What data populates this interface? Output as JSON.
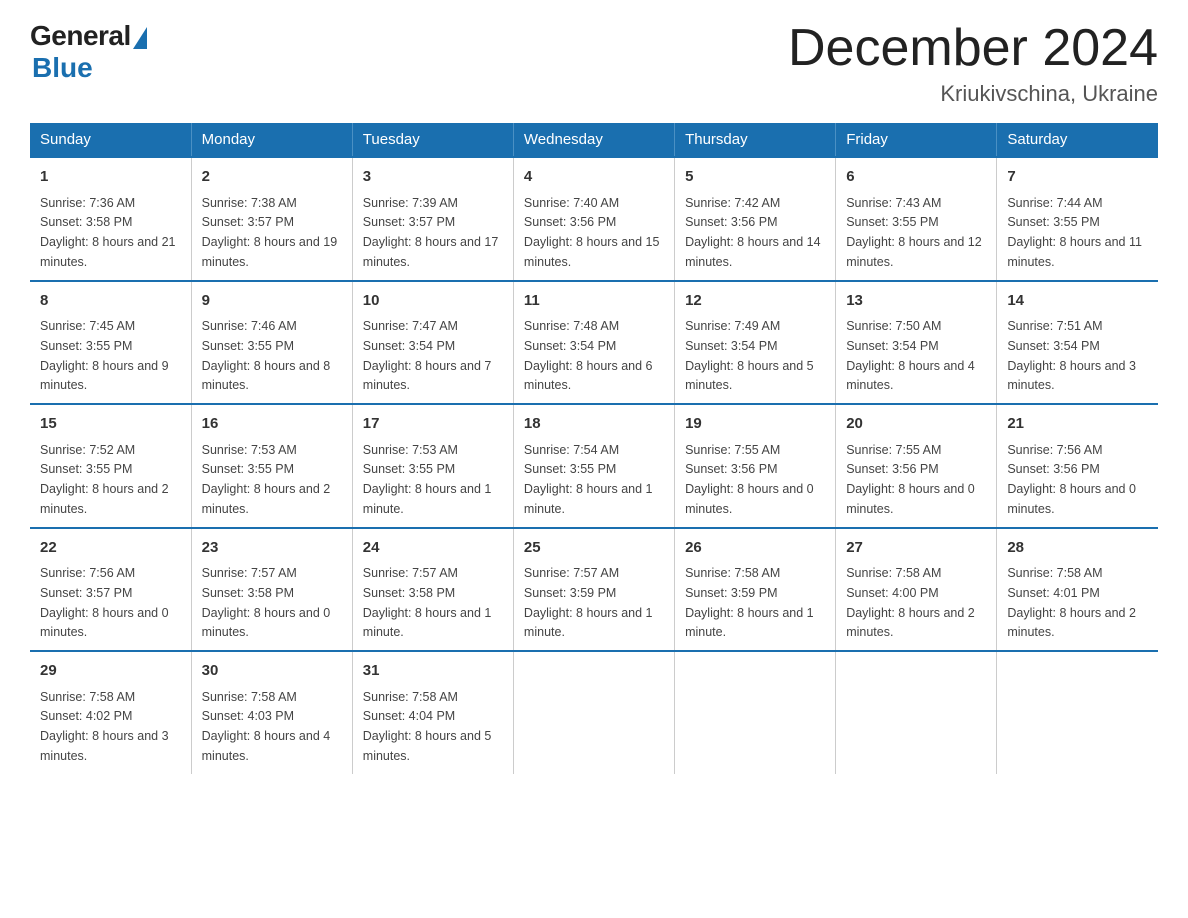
{
  "logo": {
    "general": "General",
    "blue": "Blue"
  },
  "title": "December 2024",
  "location": "Kriukivschina, Ukraine",
  "days_of_week": [
    "Sunday",
    "Monday",
    "Tuesday",
    "Wednesday",
    "Thursday",
    "Friday",
    "Saturday"
  ],
  "weeks": [
    [
      {
        "day": "1",
        "sunrise": "7:36 AM",
        "sunset": "3:58 PM",
        "daylight": "8 hours and 21 minutes."
      },
      {
        "day": "2",
        "sunrise": "7:38 AM",
        "sunset": "3:57 PM",
        "daylight": "8 hours and 19 minutes."
      },
      {
        "day": "3",
        "sunrise": "7:39 AM",
        "sunset": "3:57 PM",
        "daylight": "8 hours and 17 minutes."
      },
      {
        "day": "4",
        "sunrise": "7:40 AM",
        "sunset": "3:56 PM",
        "daylight": "8 hours and 15 minutes."
      },
      {
        "day": "5",
        "sunrise": "7:42 AM",
        "sunset": "3:56 PM",
        "daylight": "8 hours and 14 minutes."
      },
      {
        "day": "6",
        "sunrise": "7:43 AM",
        "sunset": "3:55 PM",
        "daylight": "8 hours and 12 minutes."
      },
      {
        "day": "7",
        "sunrise": "7:44 AM",
        "sunset": "3:55 PM",
        "daylight": "8 hours and 11 minutes."
      }
    ],
    [
      {
        "day": "8",
        "sunrise": "7:45 AM",
        "sunset": "3:55 PM",
        "daylight": "8 hours and 9 minutes."
      },
      {
        "day": "9",
        "sunrise": "7:46 AM",
        "sunset": "3:55 PM",
        "daylight": "8 hours and 8 minutes."
      },
      {
        "day": "10",
        "sunrise": "7:47 AM",
        "sunset": "3:54 PM",
        "daylight": "8 hours and 7 minutes."
      },
      {
        "day": "11",
        "sunrise": "7:48 AM",
        "sunset": "3:54 PM",
        "daylight": "8 hours and 6 minutes."
      },
      {
        "day": "12",
        "sunrise": "7:49 AM",
        "sunset": "3:54 PM",
        "daylight": "8 hours and 5 minutes."
      },
      {
        "day": "13",
        "sunrise": "7:50 AM",
        "sunset": "3:54 PM",
        "daylight": "8 hours and 4 minutes."
      },
      {
        "day": "14",
        "sunrise": "7:51 AM",
        "sunset": "3:54 PM",
        "daylight": "8 hours and 3 minutes."
      }
    ],
    [
      {
        "day": "15",
        "sunrise": "7:52 AM",
        "sunset": "3:55 PM",
        "daylight": "8 hours and 2 minutes."
      },
      {
        "day": "16",
        "sunrise": "7:53 AM",
        "sunset": "3:55 PM",
        "daylight": "8 hours and 2 minutes."
      },
      {
        "day": "17",
        "sunrise": "7:53 AM",
        "sunset": "3:55 PM",
        "daylight": "8 hours and 1 minute."
      },
      {
        "day": "18",
        "sunrise": "7:54 AM",
        "sunset": "3:55 PM",
        "daylight": "8 hours and 1 minute."
      },
      {
        "day": "19",
        "sunrise": "7:55 AM",
        "sunset": "3:56 PM",
        "daylight": "8 hours and 0 minutes."
      },
      {
        "day": "20",
        "sunrise": "7:55 AM",
        "sunset": "3:56 PM",
        "daylight": "8 hours and 0 minutes."
      },
      {
        "day": "21",
        "sunrise": "7:56 AM",
        "sunset": "3:56 PM",
        "daylight": "8 hours and 0 minutes."
      }
    ],
    [
      {
        "day": "22",
        "sunrise": "7:56 AM",
        "sunset": "3:57 PM",
        "daylight": "8 hours and 0 minutes."
      },
      {
        "day": "23",
        "sunrise": "7:57 AM",
        "sunset": "3:58 PM",
        "daylight": "8 hours and 0 minutes."
      },
      {
        "day": "24",
        "sunrise": "7:57 AM",
        "sunset": "3:58 PM",
        "daylight": "8 hours and 1 minute."
      },
      {
        "day": "25",
        "sunrise": "7:57 AM",
        "sunset": "3:59 PM",
        "daylight": "8 hours and 1 minute."
      },
      {
        "day": "26",
        "sunrise": "7:58 AM",
        "sunset": "3:59 PM",
        "daylight": "8 hours and 1 minute."
      },
      {
        "day": "27",
        "sunrise": "7:58 AM",
        "sunset": "4:00 PM",
        "daylight": "8 hours and 2 minutes."
      },
      {
        "day": "28",
        "sunrise": "7:58 AM",
        "sunset": "4:01 PM",
        "daylight": "8 hours and 2 minutes."
      }
    ],
    [
      {
        "day": "29",
        "sunrise": "7:58 AM",
        "sunset": "4:02 PM",
        "daylight": "8 hours and 3 minutes."
      },
      {
        "day": "30",
        "sunrise": "7:58 AM",
        "sunset": "4:03 PM",
        "daylight": "8 hours and 4 minutes."
      },
      {
        "day": "31",
        "sunrise": "7:58 AM",
        "sunset": "4:04 PM",
        "daylight": "8 hours and 5 minutes."
      },
      null,
      null,
      null,
      null
    ]
  ],
  "labels": {
    "sunrise": "Sunrise:",
    "sunset": "Sunset:",
    "daylight": "Daylight:"
  }
}
